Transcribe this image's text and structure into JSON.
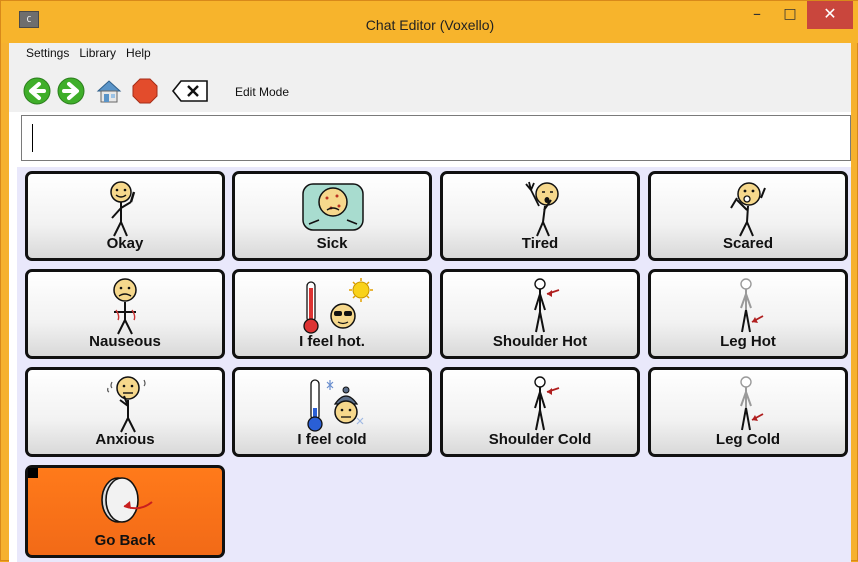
{
  "window": {
    "title": "Chat Editor (Voxello)",
    "icon_text": "C"
  },
  "menu": [
    "Settings",
    "Library",
    "Help"
  ],
  "toolbar": {
    "buttons": [
      "back-icon",
      "forward-icon",
      "home-icon",
      "stop-icon",
      "clear-icon"
    ],
    "edit_mode_label": "Edit Mode"
  },
  "message": {
    "value": ""
  },
  "grid": {
    "cells": [
      {
        "label": "Okay",
        "icon": "okay-icon"
      },
      {
        "label": "Sick",
        "icon": "sick-icon"
      },
      {
        "label": "Tired",
        "icon": "tired-icon"
      },
      {
        "label": "Scared",
        "icon": "scared-icon"
      },
      {
        "label": "Nauseous",
        "icon": "nauseous-icon"
      },
      {
        "label": "I feel hot.",
        "icon": "hot-icon"
      },
      {
        "label": "Shoulder Hot",
        "icon": "shoulder-hot-icon"
      },
      {
        "label": "Leg Hot",
        "icon": "leg-hot-icon"
      },
      {
        "label": "Anxious",
        "icon": "anxious-icon"
      },
      {
        "label": "I feel cold",
        "icon": "cold-icon"
      },
      {
        "label": "Shoulder Cold",
        "icon": "shoulder-cold-icon"
      },
      {
        "label": "Leg Cold",
        "icon": "leg-cold-icon"
      },
      {
        "label": "Go Back",
        "icon": "go-back-icon"
      }
    ]
  },
  "colors": {
    "title_bar": "#f7b42c",
    "close_button": "#c9463d",
    "grid_background": "#e9e8fb",
    "go_back_cell": "#f26a17"
  }
}
